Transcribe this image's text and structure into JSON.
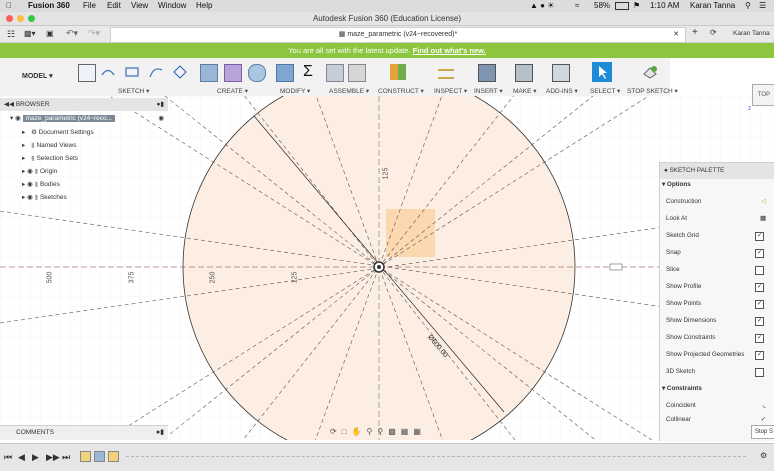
{
  "menubar": {
    "app_name": "Fusion 360",
    "menus": [
      "File",
      "Edit",
      "View",
      "Window",
      "Help"
    ],
    "battery": "58%",
    "time": "1:10 AM",
    "user": "Karan Tanna"
  },
  "window": {
    "title": "Autodesk Fusion 360 (Education License)"
  },
  "tabbar": {
    "doc_tab": "maze_parametric (v24~recovered)*",
    "user": "Karan Tanna"
  },
  "banner": {
    "text": "You are all set with the latest update.",
    "link": "Find out what's new."
  },
  "toolbar": {
    "workspace": "MODEL",
    "groups": [
      "SKETCH",
      "CREATE",
      "MODIFY",
      "ASSEMBLE",
      "CONSTRUCT",
      "INSPECT",
      "INSERT",
      "MAKE",
      "ADD-INS",
      "SELECT",
      "STOP SKETCH"
    ]
  },
  "browser": {
    "title": "BROWSER",
    "root": "maze_parametric (v24~reco...",
    "items": [
      "Document Settings",
      "Named Views",
      "Selection Sets",
      "Origin",
      "Bodies",
      "Sketches"
    ]
  },
  "viewcube": {
    "label": "TOP"
  },
  "dimensions": {
    "d500": "500",
    "d375": "375",
    "d250": "250",
    "d125_h": "125",
    "d125_v": "125",
    "diameter": "Ø600.00"
  },
  "palette": {
    "title": "SKETCH PALETTE",
    "options_header": "Options",
    "options": [
      {
        "label": "Construction",
        "checked": false
      },
      {
        "label": "Look At",
        "checked": false
      },
      {
        "label": "Sketch Grid",
        "checked": true
      },
      {
        "label": "Snap",
        "checked": true
      },
      {
        "label": "Slice",
        "checked": false
      },
      {
        "label": "Show Profile",
        "checked": true
      },
      {
        "label": "Show Points",
        "checked": true
      },
      {
        "label": "Show Dimensions",
        "checked": true
      },
      {
        "label": "Show Constraints",
        "checked": true
      },
      {
        "label": "Show Projected Geometries",
        "checked": true
      },
      {
        "label": "3D Sketch",
        "checked": false
      }
    ],
    "constraints_header": "Constraints",
    "constraints": [
      "Coincident",
      "Collinear"
    ],
    "stop_button": "Stop S"
  },
  "comments": {
    "title": "COMMENTS"
  },
  "colors": {
    "banner": "#8cc63f",
    "circle_fill": "#fdeee3",
    "profile": "#fcd8b0",
    "select_blue": "#1f8ad6"
  }
}
